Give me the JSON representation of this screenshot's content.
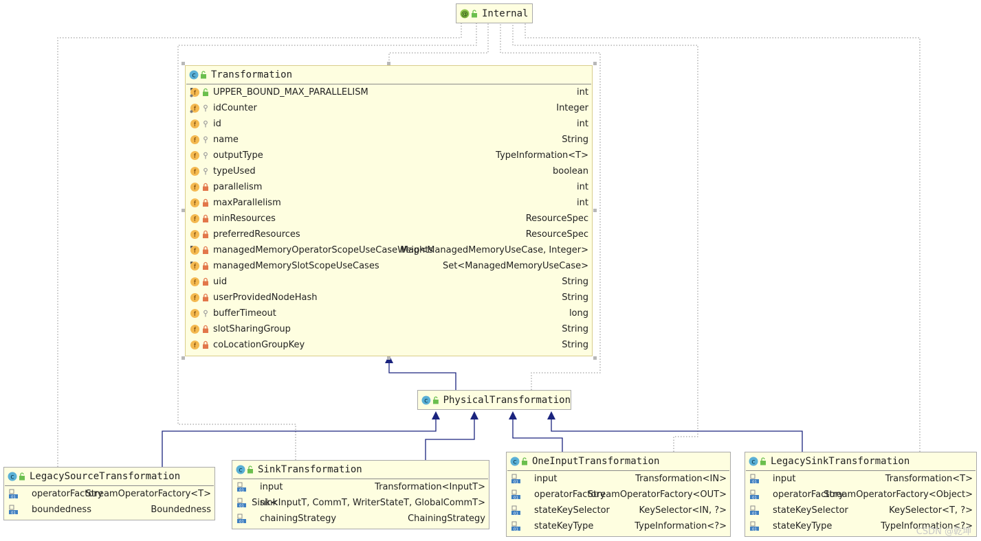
{
  "annotation": {
    "name": "Internal"
  },
  "classes": {
    "transformation": {
      "name": "Transformation",
      "fields": [
        {
          "name": "UPPER_BOUND_MAX_PARALLELISM",
          "type": "int",
          "icon": "static-final-field",
          "vis": "public"
        },
        {
          "name": "idCounter",
          "type": "Integer",
          "icon": "static-field",
          "vis": "package"
        },
        {
          "name": "id",
          "type": "int",
          "icon": "field",
          "vis": "package"
        },
        {
          "name": "name",
          "type": "String",
          "icon": "field",
          "vis": "package"
        },
        {
          "name": "outputType",
          "type": "TypeInformation<T>",
          "icon": "field",
          "vis": "package"
        },
        {
          "name": "typeUsed",
          "type": "boolean",
          "icon": "field",
          "vis": "package"
        },
        {
          "name": "parallelism",
          "type": "int",
          "icon": "field",
          "vis": "private"
        },
        {
          "name": "maxParallelism",
          "type": "int",
          "icon": "field",
          "vis": "private"
        },
        {
          "name": "minResources",
          "type": "ResourceSpec",
          "icon": "field",
          "vis": "private"
        },
        {
          "name": "preferredResources",
          "type": "ResourceSpec",
          "icon": "field",
          "vis": "private"
        },
        {
          "name": "managedMemoryOperatorScopeUseCaseWeights",
          "type": "Map<ManagedMemoryUseCase, Integer>",
          "icon": "final-field",
          "vis": "private"
        },
        {
          "name": "managedMemorySlotScopeUseCases",
          "type": "Set<ManagedMemoryUseCase>",
          "icon": "final-field",
          "vis": "private"
        },
        {
          "name": "uid",
          "type": "String",
          "icon": "field",
          "vis": "private"
        },
        {
          "name": "userProvidedNodeHash",
          "type": "String",
          "icon": "field",
          "vis": "private"
        },
        {
          "name": "bufferTimeout",
          "type": "long",
          "icon": "field",
          "vis": "package"
        },
        {
          "name": "slotSharingGroup",
          "type": "String",
          "icon": "field",
          "vis": "private"
        },
        {
          "name": "coLocationGroupKey",
          "type": "String",
          "icon": "field",
          "vis": "private"
        }
      ]
    },
    "physical": {
      "name": "PhysicalTransformation"
    },
    "legacySource": {
      "name": "LegacySourceTransformation",
      "fields": [
        {
          "name": "operatorFactory",
          "type": "StreamOperatorFactory<T>"
        },
        {
          "name": "boundedness",
          "type": "Boundedness"
        }
      ]
    },
    "sink": {
      "name": "SinkTransformation",
      "fields": [
        {
          "name": "input",
          "type": "Transformation<InputT>"
        },
        {
          "name": "sink",
          "type": "Sink<InputT, CommT, WriterStateT, GlobalCommT>"
        },
        {
          "name": "chainingStrategy",
          "type": "ChainingStrategy"
        }
      ]
    },
    "oneInput": {
      "name": "OneInputTransformation",
      "fields": [
        {
          "name": "input",
          "type": "Transformation<IN>"
        },
        {
          "name": "operatorFactory",
          "type": "StreamOperatorFactory<OUT>"
        },
        {
          "name": "stateKeySelector",
          "type": "KeySelector<IN, ?>"
        },
        {
          "name": "stateKeyType",
          "type": "TypeInformation<?>"
        }
      ]
    },
    "legacySink": {
      "name": "LegacySinkTransformation",
      "fields": [
        {
          "name": "input",
          "type": "Transformation<T>"
        },
        {
          "name": "operatorFactory",
          "type": "StreamOperatorFactory<Object>"
        },
        {
          "name": "stateKeySelector",
          "type": "KeySelector<T, ?>"
        },
        {
          "name": "stateKeyType",
          "type": "TypeInformation<?>"
        }
      ]
    }
  },
  "colors": {
    "box_fill": "#fefee0",
    "inherit_line": "#1a237e",
    "dotted_line": "#888888",
    "class_icon": "#5ab0d6",
    "field_icon": "#f4b950",
    "lock_private": "#e2764a",
    "lock_public": "#6bbf4e"
  },
  "watermark": "CSDN @乾坤"
}
